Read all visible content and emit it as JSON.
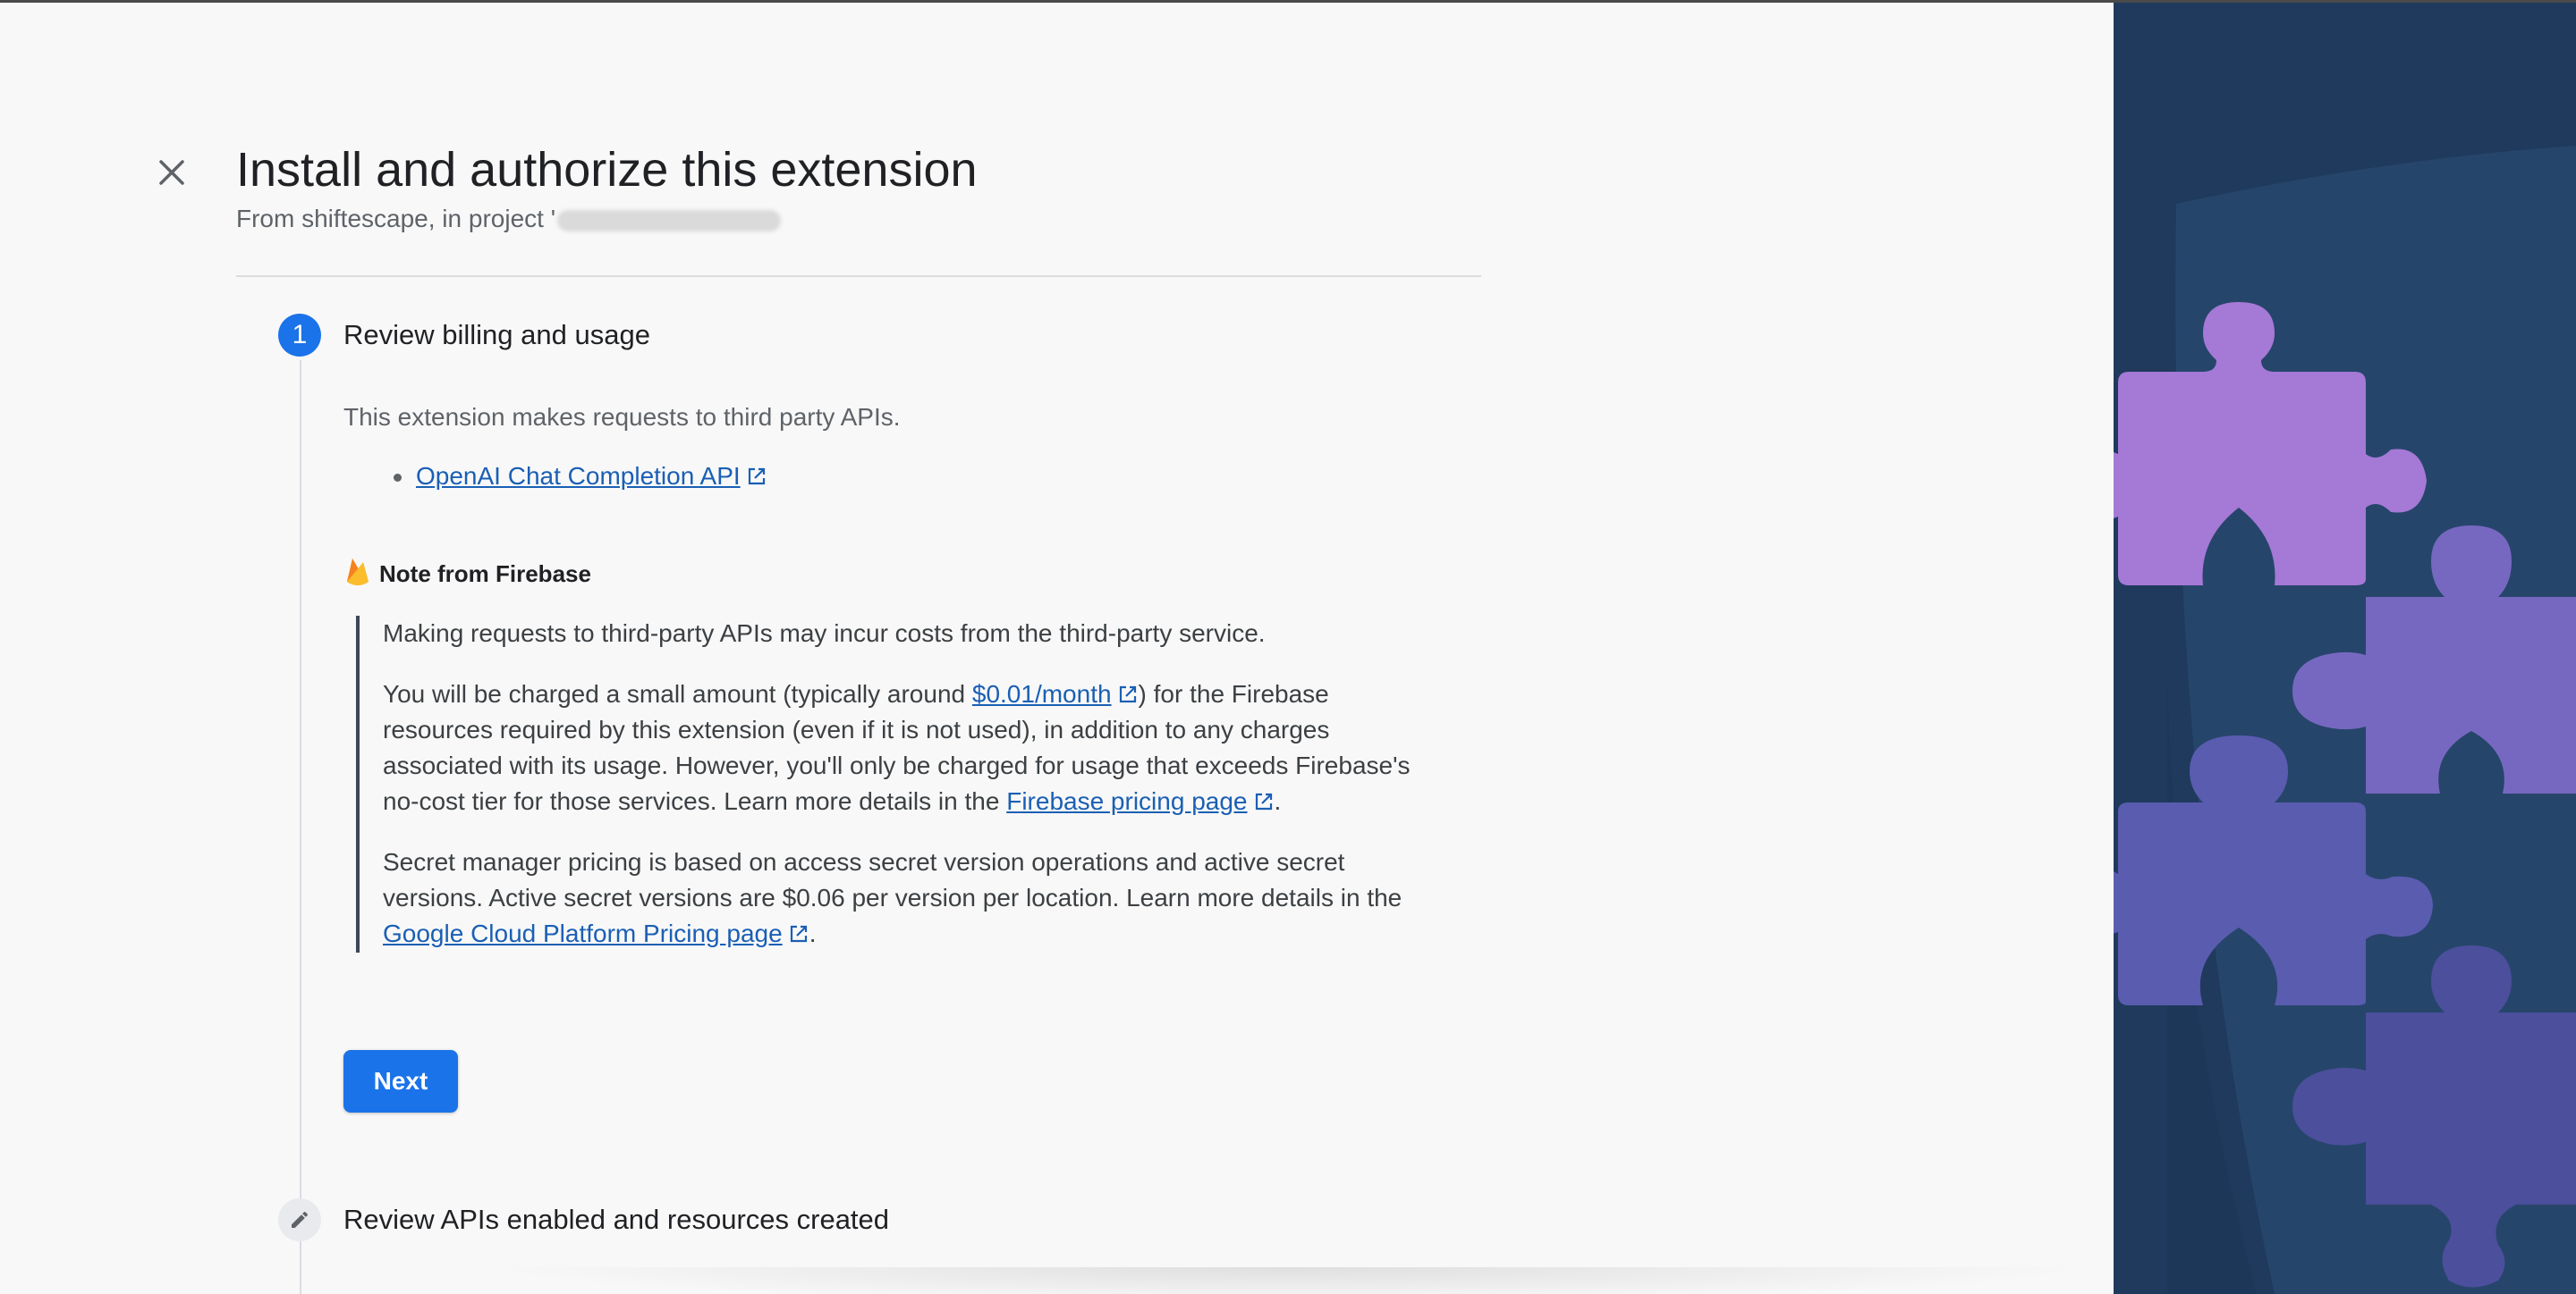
{
  "dialog": {
    "title": "Install and authorize this extension",
    "subtitle_prefix": "From shiftescape, in project '"
  },
  "step1": {
    "number": "1",
    "title": "Review billing and usage",
    "intro": "This extension makes requests to third party APIs.",
    "api_link": "OpenAI Chat Completion API",
    "note_title": "Note from Firebase",
    "note_para1": "Making requests to third-party APIs may incur costs from the third-party service.",
    "note_para2_a": "You will be charged a small amount (typically around ",
    "note_para2_link1": "$0.01/month",
    "note_para2_b": ") for the Firebase resources required by this extension (even if it is not used), in addition to any charges associated with its usage. However, you'll only be charged for usage that exceeds Firebase's no-cost tier for those services. Learn more details in the ",
    "note_para2_link2": "Firebase pricing page",
    "note_para2_c": ".",
    "note_para3_a": "Secret manager pricing is based on access secret version operations and active secret versions. Active secret versions are $0.06 per version per location. Learn more details in the ",
    "note_para3_link": "Google Cloud Platform Pricing page",
    "note_para3_c": ".",
    "next_label": "Next"
  },
  "step2": {
    "title": "Review APIs enabled and resources created"
  },
  "colors": {
    "accent": "#1a73e8",
    "link": "#1a5fb4",
    "panel_bg": "#1f3a5c"
  }
}
